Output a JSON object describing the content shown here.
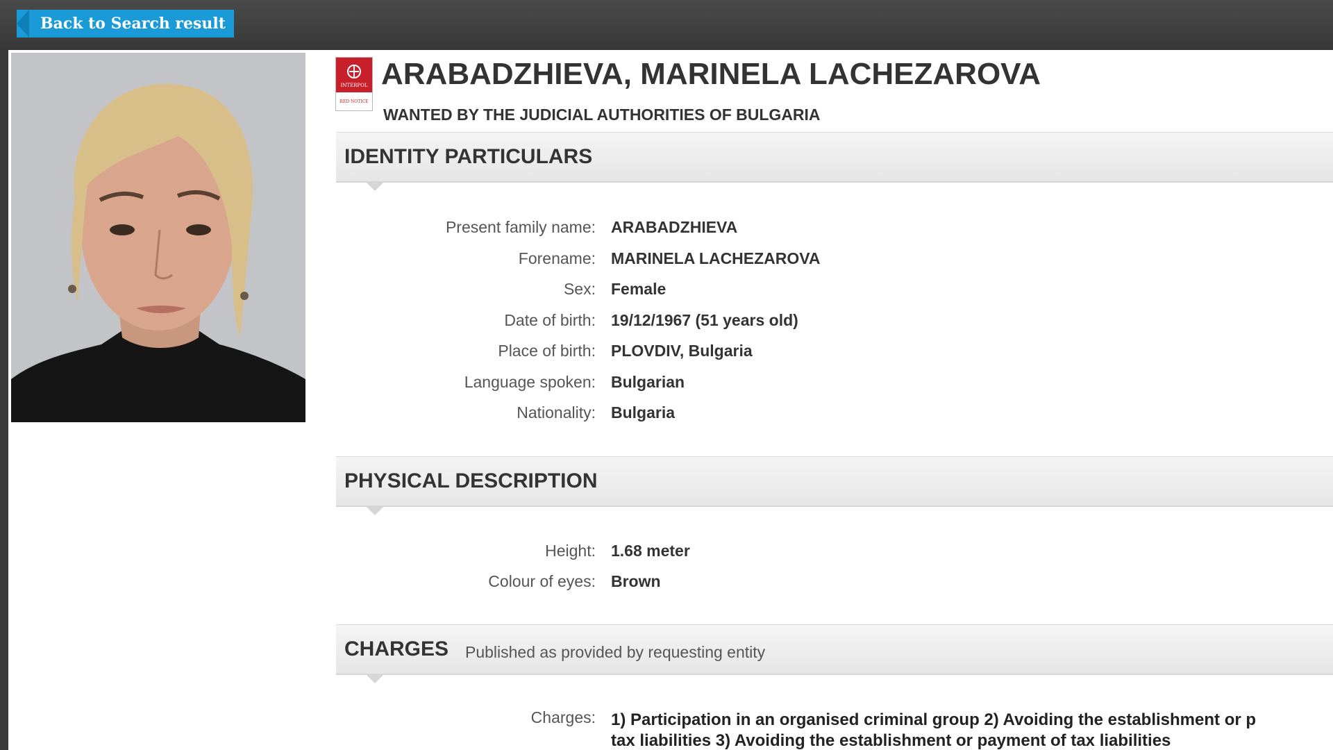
{
  "nav": {
    "back_label": "Back to Search result"
  },
  "header": {
    "name": "ARABADZHIEVA, MARINELA LACHEZAROVA",
    "wanted_by": "WANTED BY THE JUDICIAL AUTHORITIES OF BULGARIA",
    "emblem_icon": "interpol-red-notice-icon",
    "emblem_text_top": "INTERPOL",
    "emblem_text_bottom": "RED NOTICE"
  },
  "identity": {
    "title": "IDENTITY PARTICULARS",
    "rows": [
      {
        "label": "Present family name:",
        "value": "ARABADZHIEVA"
      },
      {
        "label": "Forename:",
        "value": "MARINELA LACHEZAROVA"
      },
      {
        "label": "Sex:",
        "value": "Female"
      },
      {
        "label": "Date of birth:",
        "value": "19/12/1967 (51 years old)"
      },
      {
        "label": "Place of birth:",
        "value": "PLOVDIV, Bulgaria"
      },
      {
        "label": "Language spoken:",
        "value": "Bulgarian"
      },
      {
        "label": "Nationality:",
        "value": "Bulgaria"
      }
    ]
  },
  "physical": {
    "title": "PHYSICAL DESCRIPTION",
    "rows": [
      {
        "label": "Height:",
        "value": "1.68 meter"
      },
      {
        "label": "Colour of eyes:",
        "value": "Brown"
      }
    ]
  },
  "charges": {
    "title": "CHARGES",
    "subtitle": "Published as provided by requesting entity",
    "label": "Charges:",
    "text_line1": "1) Participation in an organised criminal group 2) Avoiding the establishment or p",
    "text_line2": "tax liabilities 3) Avoiding the establishment or payment of tax liabilities"
  },
  "colors": {
    "accent": "#1a9ad6",
    "emblem_red": "#c8202b"
  }
}
